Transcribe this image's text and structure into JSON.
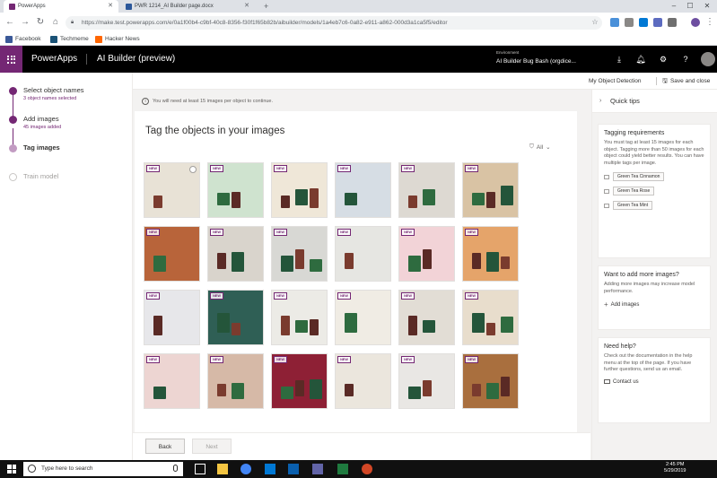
{
  "browser": {
    "tabs": [
      {
        "label": "PowerApps",
        "active": true,
        "color": "#742774"
      },
      {
        "label": "PWR 1214_AI Builder page.docx",
        "active": false,
        "color": "#2b579a"
      }
    ],
    "url": "https://make.test.powerapps.com/e/0a1f00b4-c9bf-40c8-8356-f30f1f65b82b/aibuilder/models/1a4eb7c6-0a82-e911-a862-000d3a1ca5f5/editor",
    "bookmarks": [
      "Facebook",
      "Techmeme",
      "Hacker News"
    ],
    "bookmark_colors": [
      "#3b5998",
      "#1a5276",
      "#ff6600"
    ]
  },
  "header": {
    "app_name": "PowerApps",
    "breadcrumb": "AI Builder (preview)",
    "environment_label": "Environment",
    "environment_name": "AI Builder Bug Bash (orgdice..."
  },
  "steps": [
    {
      "title": "Select object names",
      "subtitle": "3 object names selected",
      "state": "done"
    },
    {
      "title": "Add images",
      "subtitle": "45 images added",
      "state": "done"
    },
    {
      "title": "Tag images",
      "subtitle": "",
      "state": "current"
    },
    {
      "title": "Train model",
      "subtitle": "",
      "state": "todo"
    }
  ],
  "subbar": {
    "model_name": "My Object Detection",
    "save_label": "Save and close"
  },
  "main": {
    "info": "You will need at least 15 images per object to continue.",
    "title": "Tag the objects in your images",
    "filter_value": "All",
    "new_tag": "NEW",
    "image_rows": [
      [
        "#e8e2d6",
        "#cfe3cf",
        "#efe7d8",
        "#d6dde4",
        "#ddd9d2",
        "#d9c3a4"
      ],
      [
        "#b8643a",
        "#d9d4cc",
        "#d8d8d4",
        "#e6e6e2",
        "#f2d3d7",
        "#e5a46a"
      ],
      [
        "#e7e7ea",
        "#2f5f55",
        "#ecebe6",
        "#f0ece4",
        "#e2ddd5",
        "#e8ddcc"
      ],
      [
        "#edd5d2",
        "#d6b9a7",
        "#8e2035",
        "#ebe6dd",
        "#e9e7e4",
        "#a96f3e"
      ]
    ],
    "back_label": "Back",
    "next_label": "Next"
  },
  "tips": {
    "title": "Quick tips",
    "cards": [
      {
        "heading": "Tagging requirements",
        "body": "You must tag at least 15 images for each object. Tagging more than 50 images for each object could yield better results. You can have multiple tags per image.",
        "tags": [
          "Green Tea Cinnamon",
          "Green Tea Rose",
          "Green Tea Mint"
        ]
      },
      {
        "heading": "Want to add more images?",
        "body": "Adding more images may increase model performance.",
        "link": "Add images"
      },
      {
        "heading": "Need help?",
        "body": "Check out the documentation in the help menu at the top of the page. If you have further questions, send us an email.",
        "link": "Contact us"
      }
    ]
  },
  "taskbar": {
    "search_placeholder": "Type here to search",
    "time": "2:45 PM",
    "date": "5/29/2019"
  }
}
